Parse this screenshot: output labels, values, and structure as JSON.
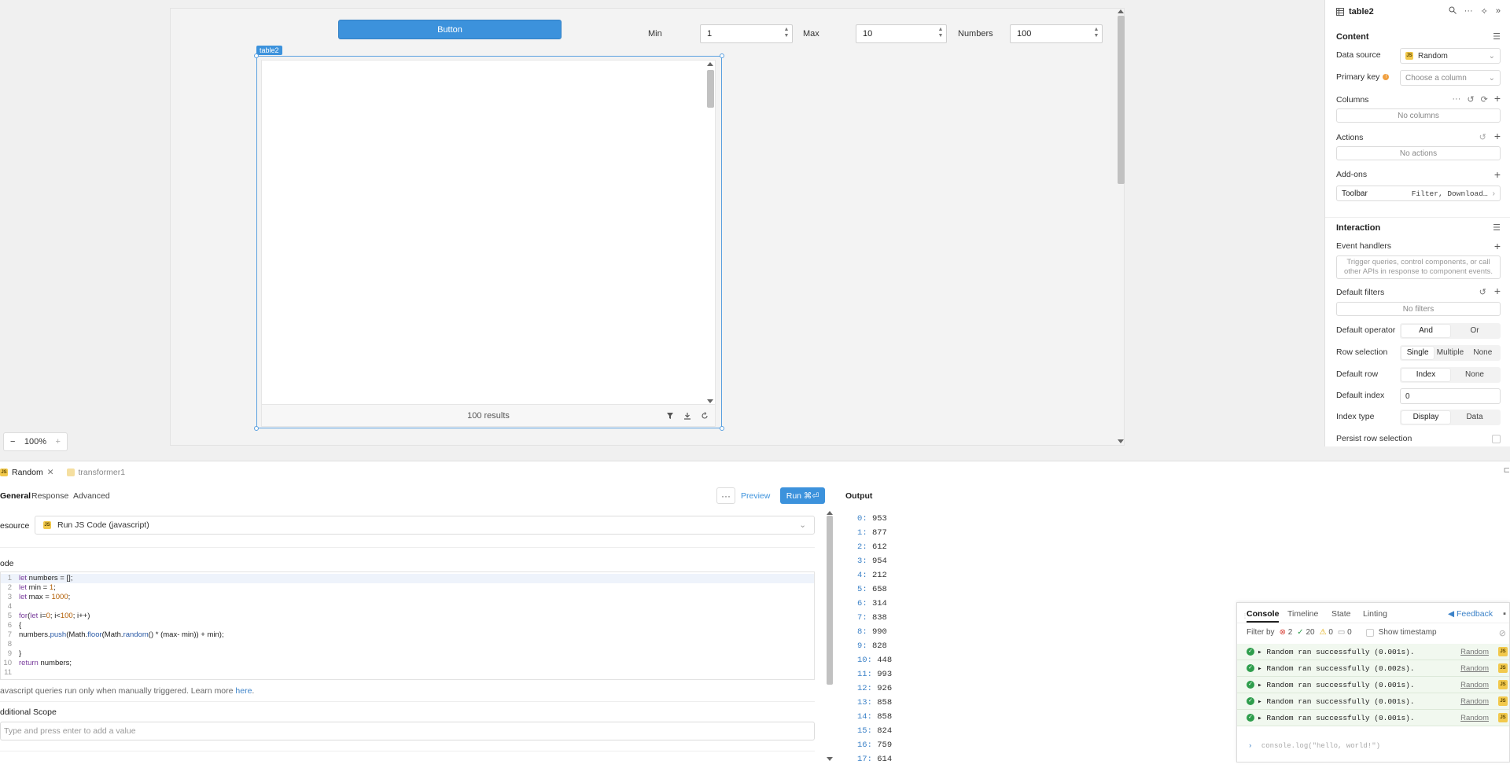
{
  "canvas": {
    "button_label": "Button",
    "min": {
      "label": "Min",
      "value": "1"
    },
    "max": {
      "label": "Max",
      "value": "10"
    },
    "numbers": {
      "label": "Numbers",
      "value": "100"
    },
    "table": {
      "tag": "table2",
      "results": "100 results"
    },
    "zoom": {
      "value": "100%",
      "minus": "−",
      "plus": "+"
    }
  },
  "inspector": {
    "title": "table2",
    "content_title": "Content",
    "data_source": {
      "label": "Data source",
      "value": "Random"
    },
    "primary_key": {
      "label": "Primary key",
      "placeholder": "Choose a column"
    },
    "columns": {
      "label": "Columns",
      "empty": "No columns"
    },
    "actions": {
      "label": "Actions",
      "empty": "No actions"
    },
    "addons": {
      "label": "Add-ons",
      "toolbar_label": "Toolbar",
      "toolbar_value": "Filter, Download…"
    },
    "interaction_title": "Interaction",
    "event_handlers": {
      "label": "Event handlers",
      "hint": "Trigger queries, control components, or call other APIs in response to component events."
    },
    "default_filters": {
      "label": "Default filters",
      "empty": "No filters"
    },
    "default_operator": {
      "label": "Default operator",
      "options": [
        "And",
        "Or"
      ],
      "selected": "And"
    },
    "row_selection": {
      "label": "Row selection",
      "options": [
        "Single",
        "Multiple",
        "None"
      ],
      "selected": "Single"
    },
    "default_row": {
      "label": "Default row",
      "options": [
        "Index",
        "None"
      ],
      "selected": "Index"
    },
    "default_index": {
      "label": "Default index",
      "value": "0"
    },
    "index_type": {
      "label": "Index type",
      "options": [
        "Display",
        "Data"
      ],
      "selected": "Display"
    },
    "persist": {
      "label": "Persist row selection"
    }
  },
  "query": {
    "tabs": [
      {
        "label": "Random",
        "active": true
      },
      {
        "label": "transformer1",
        "active": false
      }
    ],
    "subtabs": [
      "General",
      "Response",
      "Advanced"
    ],
    "more_label": "···",
    "preview_label": "Preview",
    "run_label": "Run ⌘⏎",
    "resource": {
      "label": "esource",
      "value": "Run JS Code (javascript)"
    },
    "code_label": "ode",
    "code_lines": [
      {
        "n": "1",
        "t": "let numbers = [];"
      },
      {
        "n": "2",
        "t": "let min = 1;"
      },
      {
        "n": "3",
        "t": "let max = 1000;"
      },
      {
        "n": "4",
        "t": ""
      },
      {
        "n": "5",
        "t": "for(let i=0; i<100; i++)"
      },
      {
        "n": "6",
        "t": "{"
      },
      {
        "n": "7",
        "t": "numbers.push(Math.floor(Math.random() * (max- min)) + min);"
      },
      {
        "n": "8",
        "t": ""
      },
      {
        "n": "9",
        "t": "}"
      },
      {
        "n": "10",
        "t": "return numbers;"
      },
      {
        "n": "11",
        "t": ""
      }
    ],
    "note": "avascript queries run only when manually triggered. Learn more ",
    "note_link": "here",
    "scope_label": "dditional Scope",
    "scope_placeholder": "Type and press enter to add a value"
  },
  "output": {
    "title": "Output",
    "lines": [
      {
        "k": "0",
        "v": "953"
      },
      {
        "k": "1",
        "v": "877"
      },
      {
        "k": "2",
        "v": "612"
      },
      {
        "k": "3",
        "v": "954"
      },
      {
        "k": "4",
        "v": "212"
      },
      {
        "k": "5",
        "v": "658"
      },
      {
        "k": "6",
        "v": "314"
      },
      {
        "k": "7",
        "v": "838"
      },
      {
        "k": "8",
        "v": "990"
      },
      {
        "k": "9",
        "v": "828"
      },
      {
        "k": "10",
        "v": "448"
      },
      {
        "k": "11",
        "v": "993"
      },
      {
        "k": "12",
        "v": "926"
      },
      {
        "k": "13",
        "v": "858"
      },
      {
        "k": "14",
        "v": "858"
      },
      {
        "k": "15",
        "v": "824"
      },
      {
        "k": "16",
        "v": "759"
      },
      {
        "k": "17",
        "v": "614"
      }
    ]
  },
  "console": {
    "tabs": [
      "Console",
      "Timeline",
      "State",
      "Linting"
    ],
    "feedback": "Feedback",
    "filter_label": "Filter by",
    "counts": {
      "errors": "2",
      "success": "20",
      "warnings": "0",
      "messages": "0"
    },
    "show_timestamp": "Show timestamp",
    "logs": [
      {
        "text": "▸ Random ran successfully (0.001s).",
        "src": "Random"
      },
      {
        "text": "▸ Random ran successfully (0.002s).",
        "src": "Random"
      },
      {
        "text": "▸ Random ran successfully (0.001s).",
        "src": "Random"
      },
      {
        "text": "▸ Random ran successfully (0.001s).",
        "src": "Random"
      },
      {
        "text": "▸ Random ran successfully (0.001s).",
        "src": "Random"
      }
    ],
    "input_placeholder": "console.log(\"hello, world!\")"
  },
  "colors": {
    "accent": "#3c92dc",
    "success": "#2e9d4c",
    "error": "#d9453c",
    "warning": "#e0a800"
  }
}
